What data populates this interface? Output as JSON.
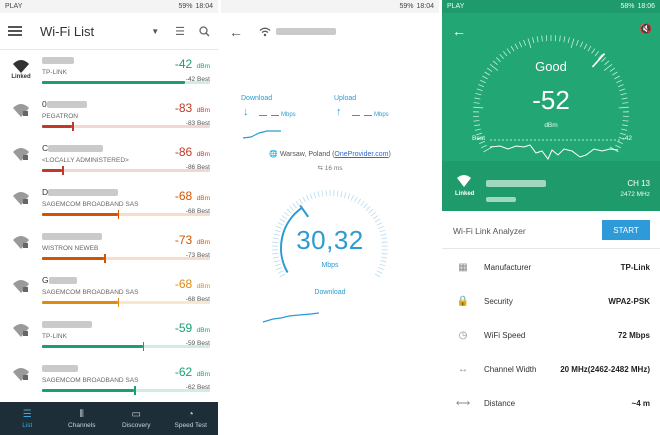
{
  "status_left": {
    "carrier": "PLAY",
    "battery": "59%",
    "time": "18:04"
  },
  "status_mid": {
    "battery": "59%",
    "time": "18:04"
  },
  "status_right": {
    "carrier": "PLAY",
    "battery": "58%",
    "time": "18:06"
  },
  "wifi_list": {
    "title": "Wi-Fi List",
    "linked_label": "Linked",
    "unit": "dBm",
    "networks": [
      {
        "name": "",
        "vendor": "TP-LINK",
        "dbm": "-42",
        "best": "-42 Best",
        "color": "#1b9e75",
        "fill": 0.85,
        "marker": null,
        "linked": true
      },
      {
        "name": "0",
        "vendor": "PEGATRON",
        "dbm": "-83",
        "best": "-83 Best",
        "color": "#c0392b",
        "fill": 0.18,
        "marker": 0.18,
        "linked": false
      },
      {
        "name": "C",
        "vendor": "<LOCALLY ADMINISTERED>",
        "dbm": "-86",
        "best": "-86 Best",
        "color": "#c0392b",
        "fill": 0.12,
        "marker": 0.12,
        "linked": false
      },
      {
        "name": "D",
        "vendor": "SAGEMCOM BROADBAND SAS",
        "dbm": "-68",
        "best": "-68 Best",
        "color": "#d35400",
        "fill": 0.45,
        "marker": 0.45,
        "linked": false
      },
      {
        "name": "",
        "vendor": "WISTRON NEWEB",
        "dbm": "-73",
        "best": "-73 Best",
        "color": "#d35400",
        "fill": 0.37,
        "marker": 0.37,
        "linked": false
      },
      {
        "name": "G",
        "vendor": "SAGEMCOM BROADBAND SAS",
        "dbm": "-68",
        "best": "-68 Best",
        "color": "#e08a10",
        "fill": 0.45,
        "marker": 0.45,
        "linked": false
      },
      {
        "name": "",
        "vendor": "TP-LINK",
        "dbm": "-59",
        "best": "-59 Best",
        "color": "#1b9e75",
        "fill": 0.6,
        "marker": 0.6,
        "linked": false
      },
      {
        "name": "",
        "vendor": "SAGEMCOM BROADBAND SAS",
        "dbm": "-62",
        "best": "-62 Best",
        "color": "#1b9e75",
        "fill": 0.55,
        "marker": 0.55,
        "linked": false
      }
    ],
    "nav": [
      {
        "label": "List",
        "icon": "list-icon",
        "glyph": "☰",
        "active": true
      },
      {
        "label": "Channels",
        "icon": "channels-icon",
        "glyph": "⫴",
        "active": false
      },
      {
        "label": "Discovery",
        "icon": "discovery-icon",
        "glyph": "▭",
        "active": false
      },
      {
        "label": "Speed Test",
        "icon": "speedometer-icon",
        "glyph": "◔",
        "active": false
      }
    ]
  },
  "speed_test": {
    "download_label": "Download",
    "upload_label": "Upload",
    "download_unit": "Mbps",
    "upload_unit": "Mbps",
    "location": "Warsaw, Poland (",
    "provider": "OneProvider.com",
    "location_end": ")",
    "ping": "16 ms",
    "value": "30,32",
    "unit": "Mbps",
    "mode": "Download"
  },
  "link_detail": {
    "quality": "Good",
    "value": "-52",
    "unit": "dBm",
    "best_label": "Best",
    "best_value": "-42",
    "linked_label": "Linked",
    "channel": "CH 13",
    "frequency": "2472 MHz",
    "analyzer_title": "Wi-Fi Link Analyzer",
    "start_label": "START",
    "properties": [
      {
        "label": "Manufacturer",
        "value": "TP-Link",
        "icon": "building-icon",
        "glyph": "▦"
      },
      {
        "label": "Security",
        "value": "WPA2-PSK",
        "icon": "lock-icon",
        "glyph": "🔒"
      },
      {
        "label": "WiFi Speed",
        "value": "72 Mbps",
        "icon": "gauge-icon",
        "glyph": "◷"
      },
      {
        "label": "Channel Width",
        "value": "20 MHz(2462-2482 MHz)",
        "icon": "width-icon",
        "glyph": "↔"
      },
      {
        "label": "Distance",
        "value": "~4 m",
        "icon": "distance-icon",
        "glyph": "⟷"
      }
    ]
  },
  "colors": {
    "green_header": "#22a674",
    "accent_blue": "#2e9ad0",
    "nav_bg": "#1d2e38"
  }
}
